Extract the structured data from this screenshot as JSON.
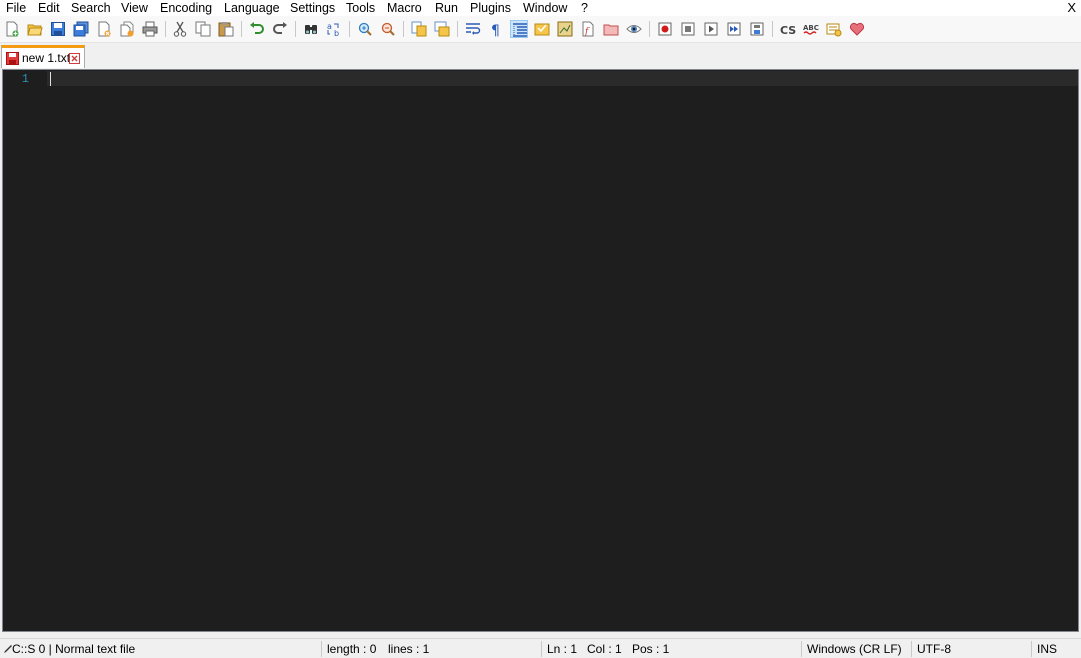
{
  "menu": {
    "items": [
      "File",
      "Edit",
      "Search",
      "View",
      "Encoding",
      "Language",
      "Settings",
      "Tools",
      "Macro",
      "Run",
      "Plugins",
      "Window",
      "?"
    ],
    "close_label": "X"
  },
  "toolbar": {
    "icons": [
      "new-file",
      "open-file",
      "save",
      "save-all",
      "close",
      "close-all",
      "print",
      "cut",
      "copy",
      "paste",
      "undo",
      "redo",
      "find",
      "replace",
      "zoom-in",
      "zoom-out",
      "sync-vertical",
      "sync-horizontal",
      "word-wrap",
      "show-all-characters",
      "indent-guide",
      "define-language",
      "document-map",
      "function-list",
      "folder-as-workspace",
      "monitoring",
      "record-macro",
      "stop-recording",
      "playback-macro",
      "run-macro-multiple",
      "save-macro",
      "cs-sync",
      "spell-check",
      "doc-switcher",
      "donate-heart"
    ],
    "active_icon": "indent-guide"
  },
  "tabs": [
    {
      "label": "new 1.txt",
      "active": true
    }
  ],
  "editor": {
    "line_numbers": [
      "1"
    ],
    "content": "",
    "theme_background": "#1e1e1e"
  },
  "status": {
    "lexer": "C::S 0 | Normal text file",
    "length": "length : 0",
    "lines": "lines : 1",
    "ln": "Ln : 1",
    "col": "Col : 1",
    "pos": "Pos : 1",
    "eol": "Windows (CR LF)",
    "encoding": "UTF-8",
    "mode": "INS"
  },
  "colors": {
    "tab_accent": "#f39c12",
    "line_number": "#2b91af"
  }
}
